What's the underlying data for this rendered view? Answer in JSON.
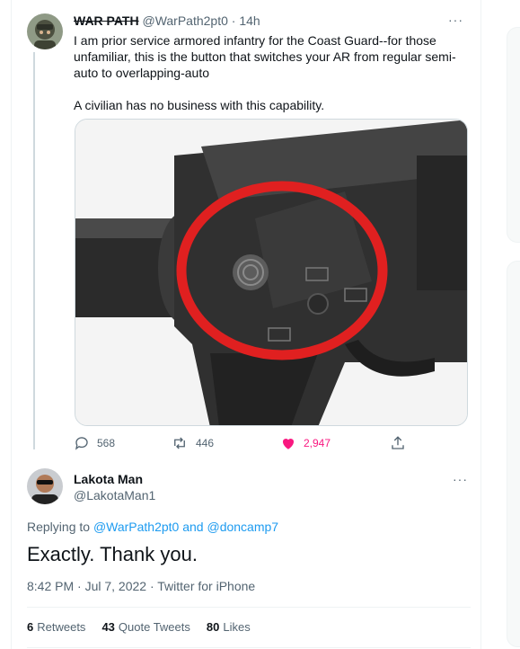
{
  "parent_tweet": {
    "display_name": "WAR PATH",
    "handle": "@WarPath2pt0",
    "time": "14h",
    "text_paragraph_1": "I am prior service armored infantry for the Coast Guard--for those unfamiliar, this is the button that switches your AR from regular semi-auto to overlapping-auto",
    "text_paragraph_2": "A civilian has no business with this capability.",
    "more_label": "···",
    "replies": "568",
    "retweets": "446",
    "likes": "2,947",
    "like_color": "#f91880"
  },
  "reply_tweet": {
    "display_name": "Lakota Man",
    "handle": "@LakotaMan1",
    "more_label": "···",
    "replying_prefix": "Replying to",
    "mention_1": "@WarPath2pt0",
    "and_text": "and",
    "mention_2": "@doncamp7",
    "text": "Exactly. Thank you.",
    "timestamp": "8:42 PM · Jul 7, 2022 · Twitter for iPhone",
    "retweets_count": "6",
    "retweets_label": "Retweets",
    "quote_count": "43",
    "quote_label": "Quote Tweets",
    "likes_count": "80",
    "likes_label": "Likes"
  },
  "colors": {
    "link": "#1d9bf0",
    "secondary_text": "#536471"
  }
}
